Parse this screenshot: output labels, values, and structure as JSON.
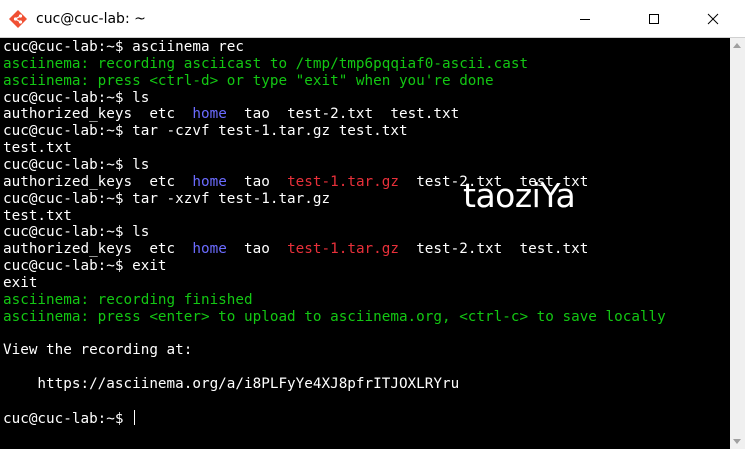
{
  "window": {
    "title": "cuc@cuc-lab: ~",
    "icon": "git-diamond-icon",
    "controls": [
      "minimize-icon",
      "maximize-icon",
      "close-icon"
    ]
  },
  "colors": {
    "prompt": "#ffffff",
    "asciinema_message": "#13c713",
    "directory": "#6b6bff",
    "archive": "#e8303a",
    "background": "#000000"
  },
  "terminal": {
    "lines": [
      [
        {
          "t": "cuc@cuc-lab:~$ asciinema rec",
          "c": "w"
        }
      ],
      [
        {
          "t": "asciinema: recording asciicast to /tmp/tmp6pqqiaf0-ascii.cast",
          "c": "g"
        }
      ],
      [
        {
          "t": "asciinema: press <ctrl-d> or type \"exit\" when you're done",
          "c": "g"
        }
      ],
      [
        {
          "t": "cuc@cuc-lab:~$ ls",
          "c": "w"
        }
      ],
      [
        {
          "t": "authorized_keys  etc  ",
          "c": "w"
        },
        {
          "t": "home",
          "c": "b"
        },
        {
          "t": "  tao  test-2.txt  test.txt",
          "c": "w"
        }
      ],
      [
        {
          "t": "cuc@cuc-lab:~$ tar -czvf test-1.tar.gz test.txt",
          "c": "w"
        }
      ],
      [
        {
          "t": "test.txt",
          "c": "w"
        }
      ],
      [
        {
          "t": "cuc@cuc-lab:~$ ls",
          "c": "w"
        }
      ],
      [
        {
          "t": "authorized_keys  etc  ",
          "c": "w"
        },
        {
          "t": "home",
          "c": "b"
        },
        {
          "t": "  tao  ",
          "c": "w"
        },
        {
          "t": "test-1.tar.gz",
          "c": "r"
        },
        {
          "t": "  test-2.txt  test.txt",
          "c": "w"
        }
      ],
      [
        {
          "t": "cuc@cuc-lab:~$ tar -xzvf test-1.tar.gz",
          "c": "w"
        }
      ],
      [
        {
          "t": "test.txt",
          "c": "w"
        }
      ],
      [
        {
          "t": "cuc@cuc-lab:~$ ls",
          "c": "w"
        }
      ],
      [
        {
          "t": "authorized_keys  etc  ",
          "c": "w"
        },
        {
          "t": "home",
          "c": "b"
        },
        {
          "t": "  tao  ",
          "c": "w"
        },
        {
          "t": "test-1.tar.gz",
          "c": "r"
        },
        {
          "t": "  test-2.txt  test.txt",
          "c": "w"
        }
      ],
      [
        {
          "t": "cuc@cuc-lab:~$ exit",
          "c": "w"
        }
      ],
      [
        {
          "t": "exit",
          "c": "w"
        }
      ],
      [
        {
          "t": "asciinema: recording finished",
          "c": "g"
        }
      ],
      [
        {
          "t": "asciinema: press <enter> to upload to asciinema.org, <ctrl-c> to save locally",
          "c": "g"
        }
      ],
      [],
      [
        {
          "t": "View the recording at:",
          "c": "w"
        }
      ],
      [],
      [
        {
          "t": "    https://asciinema.org/a/i8PLFyYe4XJ8pfrITJOXLRYru",
          "c": "w"
        }
      ],
      [],
      [
        {
          "t": "cuc@cuc-lab:~$ ",
          "c": "w"
        }
      ]
    ],
    "cursor_line": 22
  },
  "watermark": {
    "text": "taoziYa"
  }
}
